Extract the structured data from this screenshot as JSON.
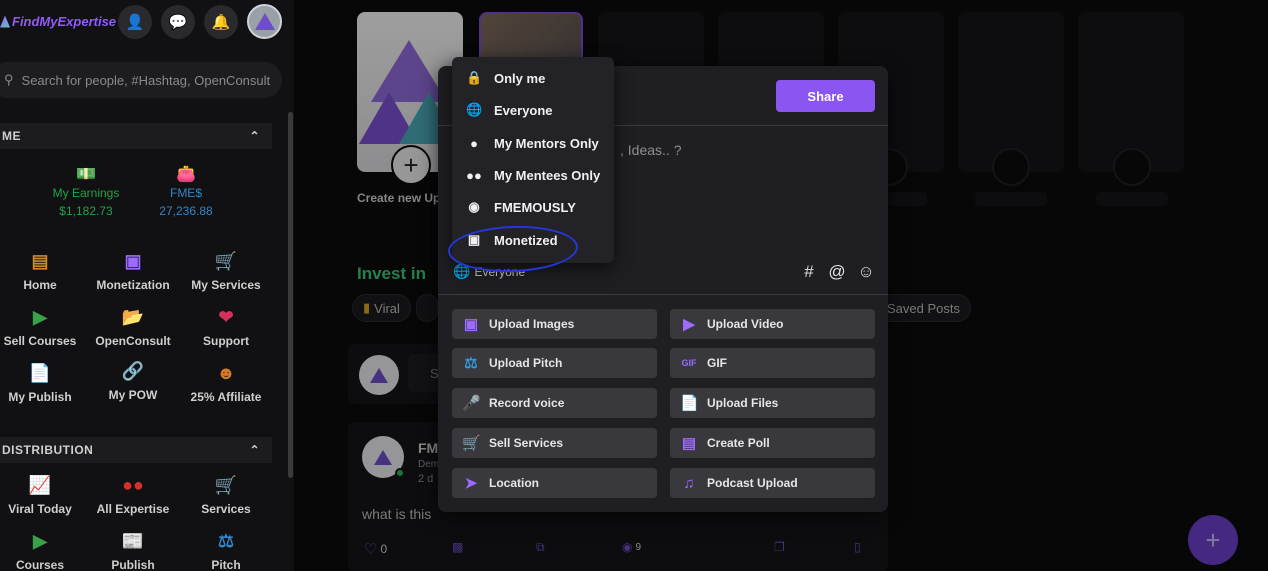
{
  "brand": {
    "name": "FindMyExpertise"
  },
  "search": {
    "placeholder": "Search for people, #Hashtag, OpenConsult"
  },
  "sections": {
    "me": {
      "title": "ME"
    },
    "distribution": {
      "title": "DISTRIBUTION"
    }
  },
  "earnings": {
    "label": "My Earnings",
    "value": "$1,182.73",
    "fmes_label": "FME$",
    "fmes_value": "27,236.88"
  },
  "me_items": [
    {
      "label": "Home",
      "icon": "home-icon"
    },
    {
      "label": "Monetization",
      "icon": "card-icon"
    },
    {
      "label": "My Services",
      "icon": "cart-icon"
    },
    {
      "label": "Sell Courses",
      "icon": "play-icon"
    },
    {
      "label": "OpenConsult",
      "icon": "folder-icon"
    },
    {
      "label": "Support",
      "icon": "support-icon"
    },
    {
      "label": "My Publish",
      "icon": "document-icon"
    },
    {
      "label": "My POW",
      "icon": "link-icon"
    },
    {
      "label": "25% Affiliate",
      "icon": "group-icon"
    }
  ],
  "distribution_items": [
    {
      "label": "Viral Today",
      "icon": "chart-icon"
    },
    {
      "label": "All Expertise",
      "icon": "people-icon"
    },
    {
      "label": "Services",
      "icon": "cart-icon"
    },
    {
      "label": "Courses",
      "icon": "play-icon"
    },
    {
      "label": "Publish",
      "icon": "newspaper-icon"
    },
    {
      "label": "Pitch",
      "icon": "pitch-icon"
    }
  ],
  "stories": {
    "create_label": "Create new Up"
  },
  "feed": {
    "invest_heading": "Invest in",
    "chips": [
      "Viral",
      "Saved Posts"
    ],
    "post_author": "FM",
    "post_sub": "Dem",
    "post_time": "2 d",
    "post_text": "what is this",
    "likes": "0",
    "views": "9",
    "composer_hint": "S"
  },
  "composer": {
    "share_label": "Share",
    "placeholder": ", Ideas.. ?",
    "audience_label": "Everyone",
    "actions": [
      {
        "label": "Upload Images",
        "icon": "image-icon"
      },
      {
        "label": "Upload Video",
        "icon": "video-icon"
      },
      {
        "label": "Upload Pitch",
        "icon": "pitch-icon"
      },
      {
        "label": "GIF",
        "icon": "gif-icon"
      },
      {
        "label": "Record voice",
        "icon": "mic-icon"
      },
      {
        "label": "Upload Files",
        "icon": "file-icon"
      },
      {
        "label": "Sell Services",
        "icon": "cart-icon"
      },
      {
        "label": "Create Poll",
        "icon": "poll-icon"
      },
      {
        "label": "Location",
        "icon": "location-icon"
      },
      {
        "label": "Podcast Upload",
        "icon": "music-icon"
      }
    ]
  },
  "audience_menu": [
    {
      "label": "Only me",
      "icon": "lock-icon"
    },
    {
      "label": "Everyone",
      "icon": "globe-icon"
    },
    {
      "label": "My Mentors Only",
      "icon": "person-icon"
    },
    {
      "label": "My Mentees Only",
      "icon": "people-icon"
    },
    {
      "label": "FMEMOUSLY",
      "icon": "incognito-icon"
    },
    {
      "label": "Monetized",
      "icon": "card-icon"
    }
  ],
  "colors": {
    "accent": "#8b55f2",
    "earnings_green": "#1fa34a",
    "fmes_blue": "#2f86c8",
    "invest_green": "#3cc47c",
    "annotation_blue": "#2437d6"
  }
}
